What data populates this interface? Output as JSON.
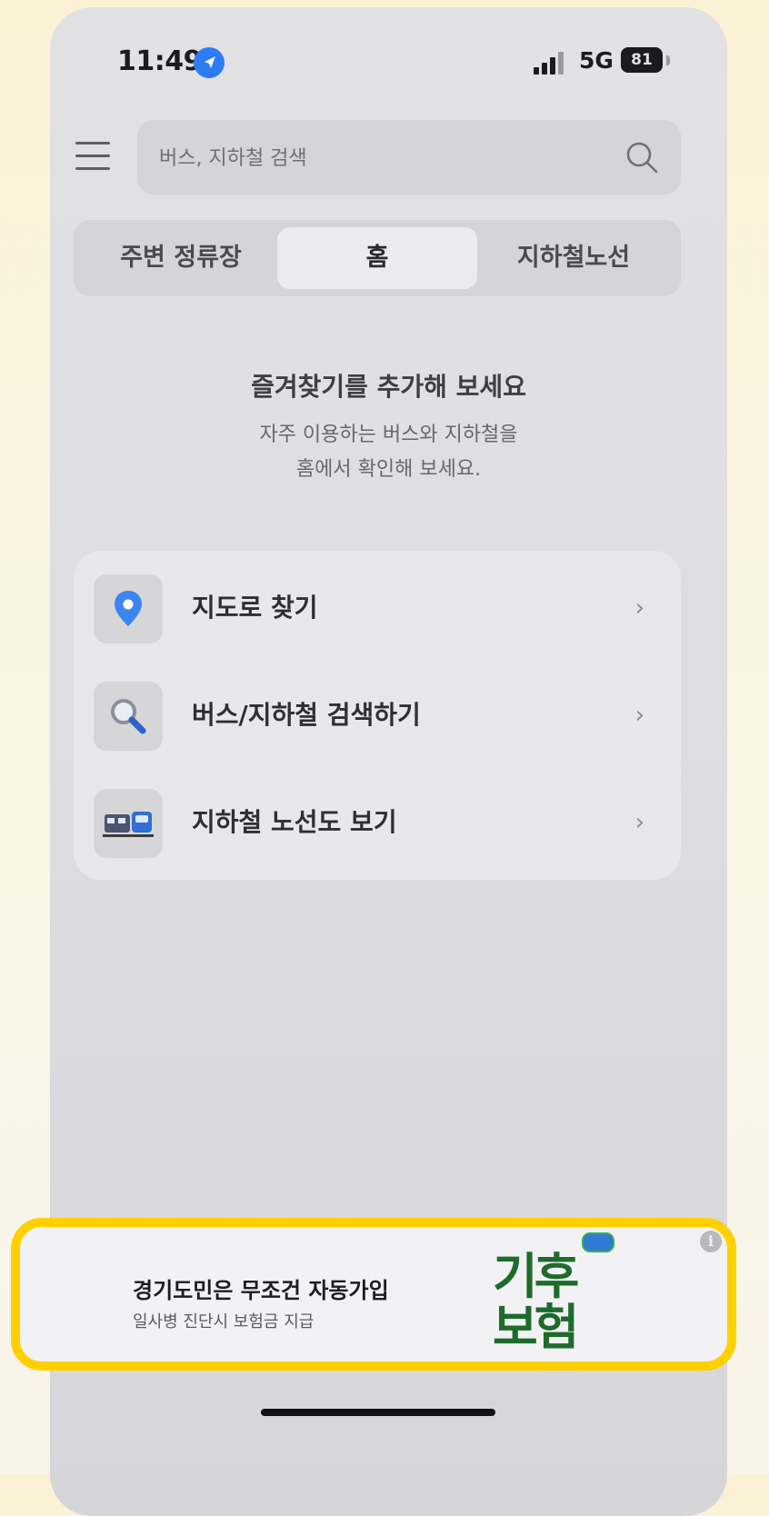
{
  "status_bar": {
    "time": "11:49",
    "network": "5G",
    "battery": "81"
  },
  "search": {
    "placeholder": "버스, 지하철 검색"
  },
  "tabs": [
    {
      "label": "주변 정류장",
      "active": false
    },
    {
      "label": "홈",
      "active": true
    },
    {
      "label": "지하철노선",
      "active": false
    }
  ],
  "empty_state": {
    "title": "즐겨찾기를 추가해 보세요",
    "line1": "자주 이용하는 버스와 지하철을",
    "line2": "홈에서 확인해 보세요."
  },
  "quick_actions": [
    {
      "label": "지도로 찾기",
      "icon": "location-pin-icon"
    },
    {
      "label": "버스/지하철 검색하기",
      "icon": "magnifier-icon"
    },
    {
      "label": "지하철 노선도 보기",
      "icon": "subway-train-icon"
    }
  ],
  "chevron": "›",
  "ad": {
    "title": "경기도민은 무조건 자동가입",
    "subtitle": "일사병 진단시 보험금 지급",
    "logo_line1": "기후",
    "logo_line2": "보험",
    "info_glyph": "i",
    "logo_color": "#1e6b2c",
    "border_color": "#ffd000"
  },
  "colors": {
    "accent": "#2d7cf6"
  }
}
